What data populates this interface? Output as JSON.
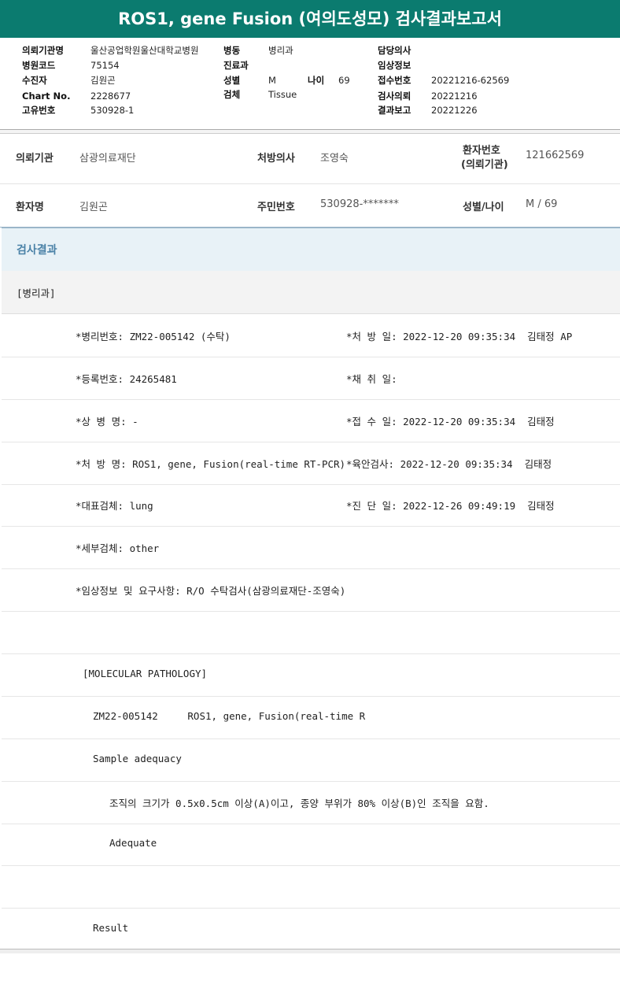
{
  "title": "ROS1, gene Fusion (여의도성모) 검사결과보고서",
  "header": {
    "fields": [
      {
        "label": "의뢰기관명",
        "value": "울산공업학원울산대학교병원"
      },
      {
        "label": "병원코드",
        "value": "75154"
      },
      {
        "label": "수진자",
        "value": "김원곤"
      },
      {
        "label": "Chart No.",
        "value": "2228677"
      },
      {
        "label": "고유번호",
        "value": "530928-1"
      },
      {
        "label": "병동",
        "value": "병리과"
      },
      {
        "label": "진료과",
        "value": ""
      },
      {
        "label": "성별",
        "value": "M"
      },
      {
        "label": "나이",
        "value": "69"
      },
      {
        "label": "검체",
        "value": "Tissue"
      },
      {
        "label": "담당의사",
        "value": ""
      },
      {
        "label": "임상정보",
        "value": ""
      },
      {
        "label": "접수번호",
        "value": "20221216-62569"
      },
      {
        "label": "검사의뢰",
        "value": "20221216"
      },
      {
        "label": "결과보고",
        "value": "20221226"
      }
    ]
  },
  "patient_info": {
    "request_org_label": "의뢰기관",
    "request_org": "삼광의료재단",
    "doctor_label": "처방의사",
    "doctor": "조영숙",
    "patient_no_label": "환자번호",
    "patient_no_label2": "(의뢰기관)",
    "patient_no": "121662569",
    "name_label": "환자명",
    "name": "김원곤",
    "rrn_label": "주민번호",
    "rrn": "530928-*******",
    "sex_age_label": "성별/나이",
    "sex_age": "M / 69"
  },
  "results": {
    "section_title": "검사결과",
    "dept": "[병리과]",
    "left": [
      "*병리번호: ZM22-005142 (수탁)",
      "*등록번호: 24265481",
      "*상 병 명: -",
      "*처 방 명: ROS1, gene, Fusion(real-time RT-PCR)",
      "*대표검체: lung",
      "*세부검체: other",
      "*임상정보 및 요구사항: R/O 수탁검사(삼광의료재단-조영숙)"
    ],
    "right": [
      "*처 방 일: 2022-12-20 09:35:34  김태정 AP",
      "*채 취 일:",
      "*접 수 일: 2022-12-20 09:35:34  김태정",
      "*육안검사: 2022-12-20 09:35:34  김태정",
      "*진 단 일: 2022-12-26 09:49:19  김태정"
    ],
    "molecular_header": "[MOLECULAR PATHOLOGY]",
    "test_line": "ZM22-005142     ROS1, gene, Fusion(real-time R",
    "adequacy_label": "Sample adequacy",
    "adequacy_text": "조직의 크기가 0.5x0.5cm 이상(A)이고, 종양 부위가 80% 이상(B)인 조직을 요함.",
    "adequacy_value": "Adequate",
    "result_label": "Result"
  },
  "colors": {
    "title_bar": "#0b7b6f",
    "section_text": "#4a82a7",
    "section_bg": "#e8f2f7"
  }
}
